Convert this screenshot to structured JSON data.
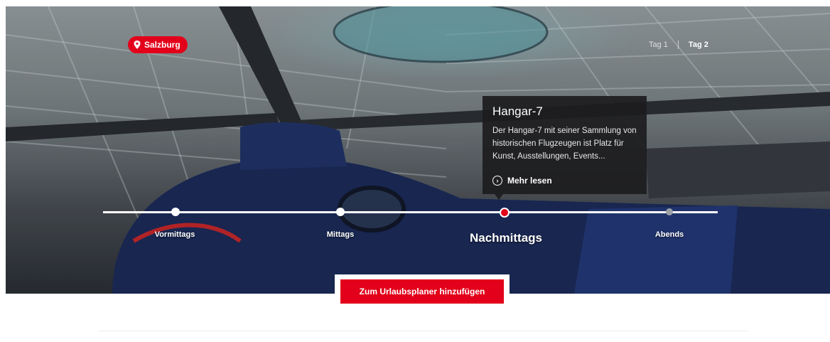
{
  "hero": {
    "location": "Salzburg",
    "days": [
      {
        "label": "Tag 1",
        "active": false
      },
      {
        "label": "Tag 2",
        "active": true
      }
    ]
  },
  "timeline": {
    "points": [
      {
        "label": "Vormittags",
        "state": "done"
      },
      {
        "label": "Mittags",
        "state": "done"
      },
      {
        "label": "Nachmittags",
        "state": "active"
      },
      {
        "label": "Abends",
        "state": "upcoming"
      }
    ]
  },
  "card": {
    "title": "Hangar-7",
    "text": "Der Hangar-7 mit seiner Sammlung von historischen Flugzeugen ist Platz für Kunst, Ausstellungen, Events...",
    "link": "Mehr lesen"
  },
  "cta": {
    "label": "Zum Urlaubsplaner hinzufügen"
  },
  "colors": {
    "accent": "#e2001a",
    "card_bg": "#1c1c1e"
  },
  "icons": {
    "location": "map-pin-icon",
    "link": "chevron-circle-icon"
  }
}
